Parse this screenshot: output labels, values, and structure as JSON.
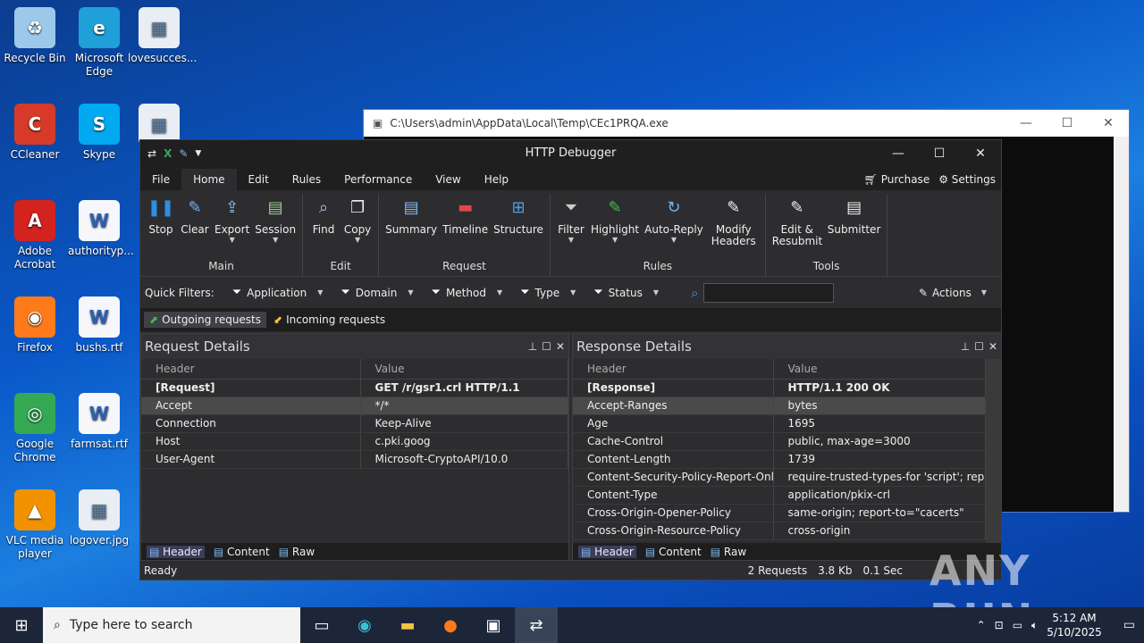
{
  "desktop": {
    "icons": [
      {
        "label": "Recycle Bin",
        "icon": "recycle-bin-icon"
      },
      {
        "label": "Microsoft Edge",
        "icon": "edge-icon"
      },
      {
        "label": "lovesucces...",
        "icon": "image-file-icon"
      },
      {
        "label": "CCleaner",
        "icon": "ccleaner-icon"
      },
      {
        "label": "Skype",
        "icon": "skype-icon"
      },
      {
        "label": "",
        "icon": "image-file-icon"
      },
      {
        "label": "Adobe Acrobat",
        "icon": "acrobat-icon"
      },
      {
        "label": "authorityp...",
        "icon": "word-doc-icon"
      },
      {
        "label": "Firefox",
        "icon": "firefox-icon"
      },
      {
        "label": "bushs.rtf",
        "icon": "word-doc-icon"
      },
      {
        "label": "Google Chrome",
        "icon": "chrome-icon"
      },
      {
        "label": "farmsat.rtf",
        "icon": "word-doc-icon"
      },
      {
        "label": "VLC media player",
        "icon": "vlc-icon"
      },
      {
        "label": "logover.jpg",
        "icon": "image-file-icon"
      }
    ]
  },
  "console": {
    "title": "C:\\Users\\admin\\AppData\\Local\\Temp\\CEc1PRQA.exe"
  },
  "app": {
    "title": "HTTP Debugger",
    "menu": [
      "File",
      "Home",
      "Edit",
      "Rules",
      "Performance",
      "View",
      "Help"
    ],
    "purchase": "Purchase",
    "settings": "Settings",
    "groups": [
      {
        "label": "Main",
        "buttons": [
          "Stop",
          "Clear",
          "Export",
          "Session"
        ]
      },
      {
        "label": "Edit",
        "buttons": [
          "Find",
          "Copy"
        ]
      },
      {
        "label": "Request",
        "buttons": [
          "Summary",
          "Timeline",
          "Structure"
        ]
      },
      {
        "label": "Rules",
        "buttons": [
          "Filter",
          "Highlight",
          "Auto-Reply",
          "Modify Headers"
        ]
      },
      {
        "label": "Tools",
        "buttons": [
          "Edit & Resubmit",
          "Submitter"
        ]
      }
    ],
    "quick_filters": {
      "label": "Quick Filters:",
      "filters": [
        "Application",
        "Domain",
        "Method",
        "Type",
        "Status"
      ],
      "actions": "Actions"
    },
    "tabs": [
      "Outgoing requests",
      "Incoming requests"
    ],
    "request": {
      "title": "Request Details",
      "col_header": "Header",
      "col_value": "Value",
      "rows": [
        [
          "[Request]",
          "GET /r/gsr1.crl HTTP/1.1"
        ],
        [
          "Accept",
          "*/*"
        ],
        [
          "Connection",
          "Keep-Alive"
        ],
        [
          "Host",
          "c.pki.goog"
        ],
        [
          "User-Agent",
          "Microsoft-CryptoAPI/10.0"
        ]
      ]
    },
    "response": {
      "title": "Response Details",
      "col_header": "Header",
      "col_value": "Value",
      "rows": [
        [
          "[Response]",
          "HTTP/1.1 200 OK"
        ],
        [
          "Accept-Ranges",
          "bytes"
        ],
        [
          "Age",
          "1695"
        ],
        [
          "Cache-Control",
          "public, max-age=3000"
        ],
        [
          "Content-Length",
          "1739"
        ],
        [
          "Content-Security-Policy-Report-Only",
          "require-trusted-types-for 'script'; report..."
        ],
        [
          "Content-Type",
          "application/pkix-crl"
        ],
        [
          "Cross-Origin-Opener-Policy",
          "same-origin; report-to=\"cacerts\""
        ],
        [
          "Cross-Origin-Resource-Policy",
          "cross-origin"
        ]
      ]
    },
    "bottom_tabs": [
      "Header",
      "Content",
      "Raw"
    ],
    "status": {
      "left": "Ready",
      "requests": "2 Requests",
      "size": "3.8 Kb",
      "time": "0.1 Sec"
    }
  },
  "taskbar": {
    "search_placeholder": "Type here to search",
    "time": "5:12 AM",
    "date": "5/10/2025"
  },
  "watermark": "ANY RUN"
}
